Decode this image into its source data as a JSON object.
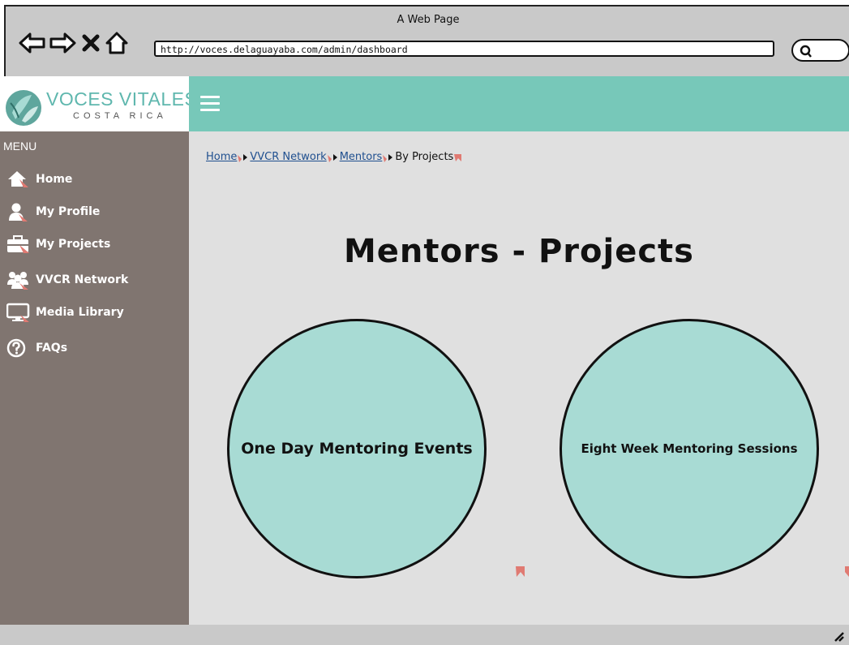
{
  "window": {
    "title": "A Web Page",
    "url": "http://voces.delaguayaba.com/admin/dashboard"
  },
  "icons": {
    "back": "arrow-left-icon",
    "forward": "arrow-right-icon",
    "stop": "close-icon",
    "home": "home-icon",
    "search": "search-icon",
    "menu": "hamburger-icon",
    "resize": "resize-grip-icon"
  },
  "brand": {
    "name": "VOCES VITALES",
    "sub": "COSTA RICA",
    "colors": {
      "teal": "#77c8b9",
      "sidebar": "#807570",
      "circle": "#a8dbd4",
      "marker": "#e07a72"
    }
  },
  "sidebar": {
    "menu_label": "MENU",
    "items": [
      {
        "label": "Home",
        "icon": "home-icon"
      },
      {
        "label": "My Profile",
        "icon": "user-icon"
      },
      {
        "label": "My Projects",
        "icon": "briefcase-icon"
      },
      {
        "label": "VVCR Network",
        "icon": "users-icon"
      },
      {
        "label": "Media Library",
        "icon": "monitor-icon"
      },
      {
        "label": "FAQs",
        "icon": "help-icon"
      }
    ]
  },
  "breadcrumb": {
    "items": [
      "Home",
      "VVCR Network",
      "Mentors"
    ],
    "current": "By Projects"
  },
  "main": {
    "title": "Mentors - Projects",
    "cards": [
      {
        "label": "One Day Mentoring Events"
      },
      {
        "label": "Eight Week Mentoring Sessions"
      }
    ]
  }
}
